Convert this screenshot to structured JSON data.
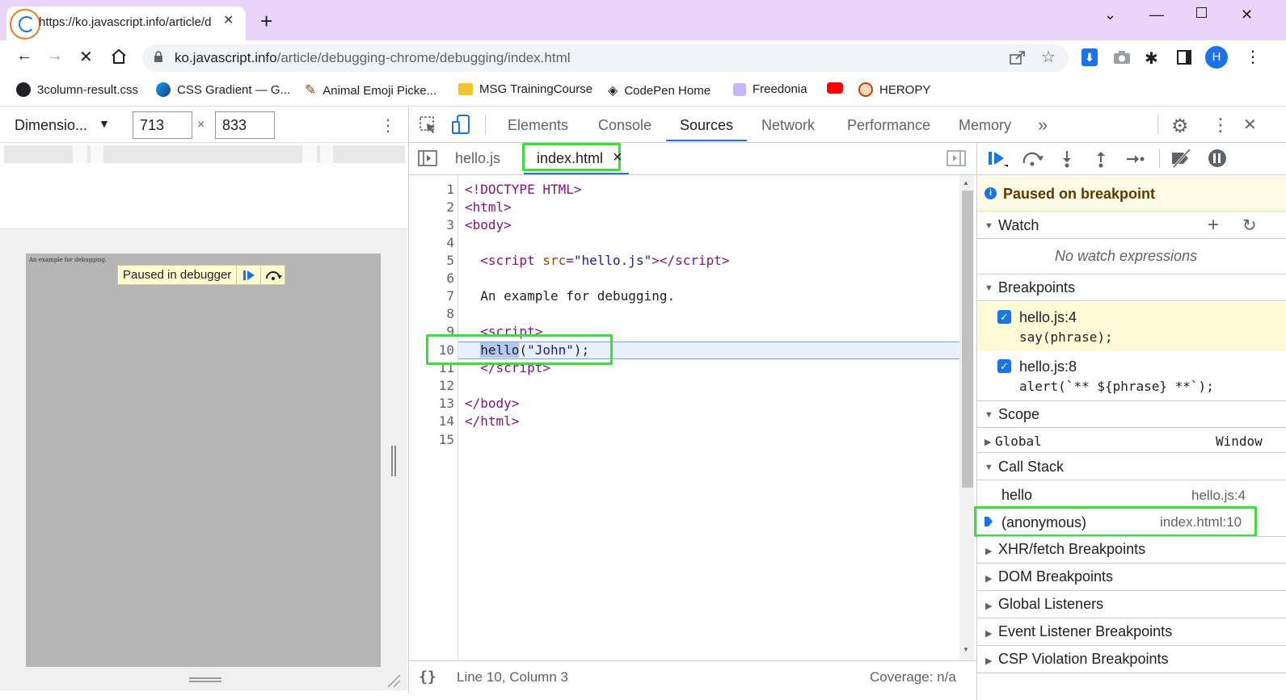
{
  "browser": {
    "tab_title": "https://ko.javascript.info/article/d",
    "url_host": "ko.javascript.info",
    "url_path": "/article/debugging-chrome/debugging/index.html",
    "profile_initial": "H"
  },
  "bookmarks": [
    {
      "label": "3column-result.css",
      "color": "#202124"
    },
    {
      "label": "CSS Gradient — G...",
      "color": "#1e3a8a"
    },
    {
      "label": "Animal Emoji Picke...",
      "color": "#8b4513"
    },
    {
      "label": "MSG TrainingCourse",
      "color": "#f4c430"
    },
    {
      "label": "CodePen Home",
      "color": "#202124"
    },
    {
      "label": "Freedonia",
      "color": "#a78bfa"
    },
    {
      "label": "",
      "color": "#ff0000"
    },
    {
      "label": "HEROPY",
      "color": "#c2410c"
    }
  ],
  "device": {
    "dimension_label": "Dimensio...",
    "width": "713",
    "height": "833",
    "times": "×",
    "page_text": "An example for debugging.",
    "paused_label": "Paused in debugger"
  },
  "devtools": {
    "tabs": [
      "Elements",
      "Console",
      "Sources",
      "Network",
      "Performance",
      "Memory"
    ],
    "more": "»",
    "files": [
      "hello.js",
      "index.html"
    ],
    "line_numbers": [
      "1",
      "2",
      "3",
      "4",
      "5",
      "6",
      "7",
      "8",
      "9",
      "10",
      "11",
      "12",
      "13",
      "14",
      "15"
    ],
    "status_pos": "Line 10, Column 3",
    "status_cov": "Coverage: n/a"
  },
  "debugger": {
    "paused_banner": "Paused on breakpoint",
    "watch_label": "Watch",
    "no_watch": "No watch expressions",
    "breakpoints_label": "Breakpoints",
    "breakpoints": [
      {
        "file": "hello.js:4",
        "code": "say(phrase);"
      },
      {
        "file": "hello.js:8",
        "code": "alert(`** ${phrase} **`);"
      }
    ],
    "scope_label": "Scope",
    "scope_global": "Global",
    "scope_global_value": "Window",
    "callstack_label": "Call Stack",
    "callstack": [
      {
        "name": "hello",
        "loc": "hello.js:4"
      },
      {
        "name": "(anonymous)",
        "loc": "index.html:10"
      }
    ],
    "sections": [
      "XHR/fetch Breakpoints",
      "DOM Breakpoints",
      "Global Listeners",
      "Event Listener Breakpoints",
      "CSP Violation Breakpoints"
    ]
  }
}
